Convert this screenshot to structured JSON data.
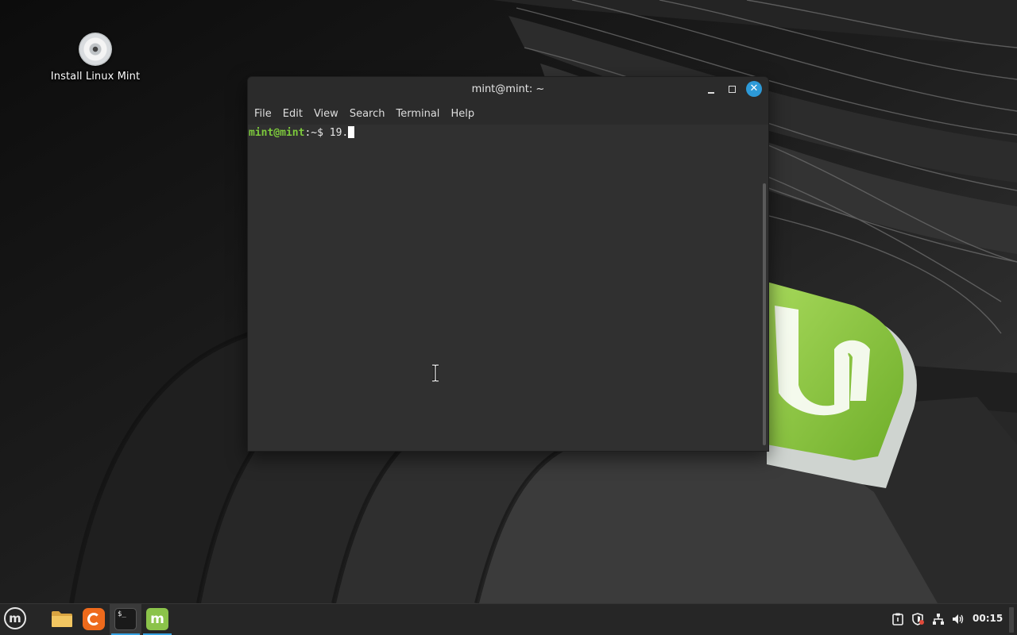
{
  "desktop": {
    "icons": [
      {
        "label": "Install Linux Mint",
        "icon": "disc-icon"
      }
    ]
  },
  "terminal_window": {
    "title": "mint@mint: ~",
    "buttons": {
      "minimize": "minimize-icon",
      "maximize": "maximize-icon",
      "close": "close-icon"
    },
    "menu": [
      "File",
      "Edit",
      "View",
      "Search",
      "Terminal",
      "Help"
    ],
    "prompt_user": "mint@mint",
    "prompt_sep": ":~$ ",
    "command_text": "19."
  },
  "taskbar": {
    "launchers": [
      {
        "name": "menu",
        "icon": "mint-menu-icon"
      },
      {
        "name": "files",
        "icon": "folder-icon"
      },
      {
        "name": "firefox",
        "icon": "firefox-icon"
      },
      {
        "name": "terminal",
        "icon": "terminal-icon",
        "active": true
      },
      {
        "name": "mintinstall",
        "icon": "mint-app-icon"
      }
    ],
    "tray": [
      "clipboard-icon",
      "shield-icon",
      "network-icon",
      "volume-icon"
    ],
    "clock": "00:15"
  },
  "colors": {
    "accent": "#35a0e0",
    "close_button": "#2d9ad8",
    "prompt_user": "#7dc93c",
    "mint_green": "#8bc34a"
  }
}
